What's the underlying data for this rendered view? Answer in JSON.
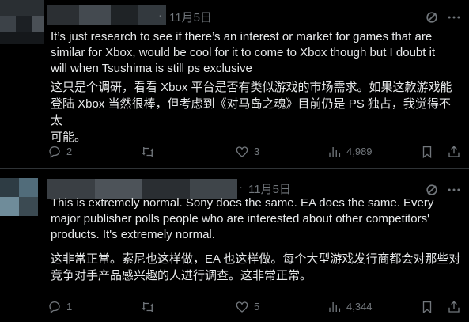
{
  "posts": [
    {
      "date": "11月5日",
      "text_en": "It’s just research to see if there’s an interest or market for games that are similar for Xbox, would be cool for it to come to Xbox though but I doubt it will when Tsushima is still ps exclusive",
      "text_zh_lines": [
        "这只是个调研，看看 Xbox 平台是否有类似游戏的市场需求。如果这款游戏能",
        "登陆 Xbox 当然很棒，但考虑到《对马岛之魂》目前仍是 PS 独占，我觉得不太",
        "可能。"
      ],
      "text_en_lines": [
        "It’s just research to see if there’s an interest or market for games that are",
        "similar for Xbox, would be cool for it to come to Xbox though but I doubt it",
        "will when Tsushima is still ps exclusive"
      ],
      "replies": "2",
      "reposts": "",
      "likes": "3",
      "views": "4,989"
    },
    {
      "date": "11月5日",
      "text_en_lines": [
        "This is extremely normal. Sony does the same. EA does the same. Every",
        "major publisher polls people who are interested about other competitors'",
        "products. It's extremely normal."
      ],
      "text_zh_lines": [
        "这非常正常。索尼也这样做，EA 也这样做。每个大型游戏发行商都会对那些对",
        "竞争对手产品感兴趣的人进行调查。这非常正常。"
      ],
      "replies": "1",
      "reposts": "",
      "likes": "5",
      "views": "4,344"
    }
  ],
  "icons": {
    "reply": "reply-icon",
    "repost": "repost-icon",
    "like": "heart-icon",
    "views": "views-chart-icon",
    "bookmark": "bookmark-icon",
    "share": "share-icon",
    "grok": "grok-icon",
    "more": "more-dots-icon"
  },
  "colors": {
    "background": "#000000",
    "text": "#e7e9ea",
    "muted": "#71767b",
    "divider": "#2f3336"
  }
}
